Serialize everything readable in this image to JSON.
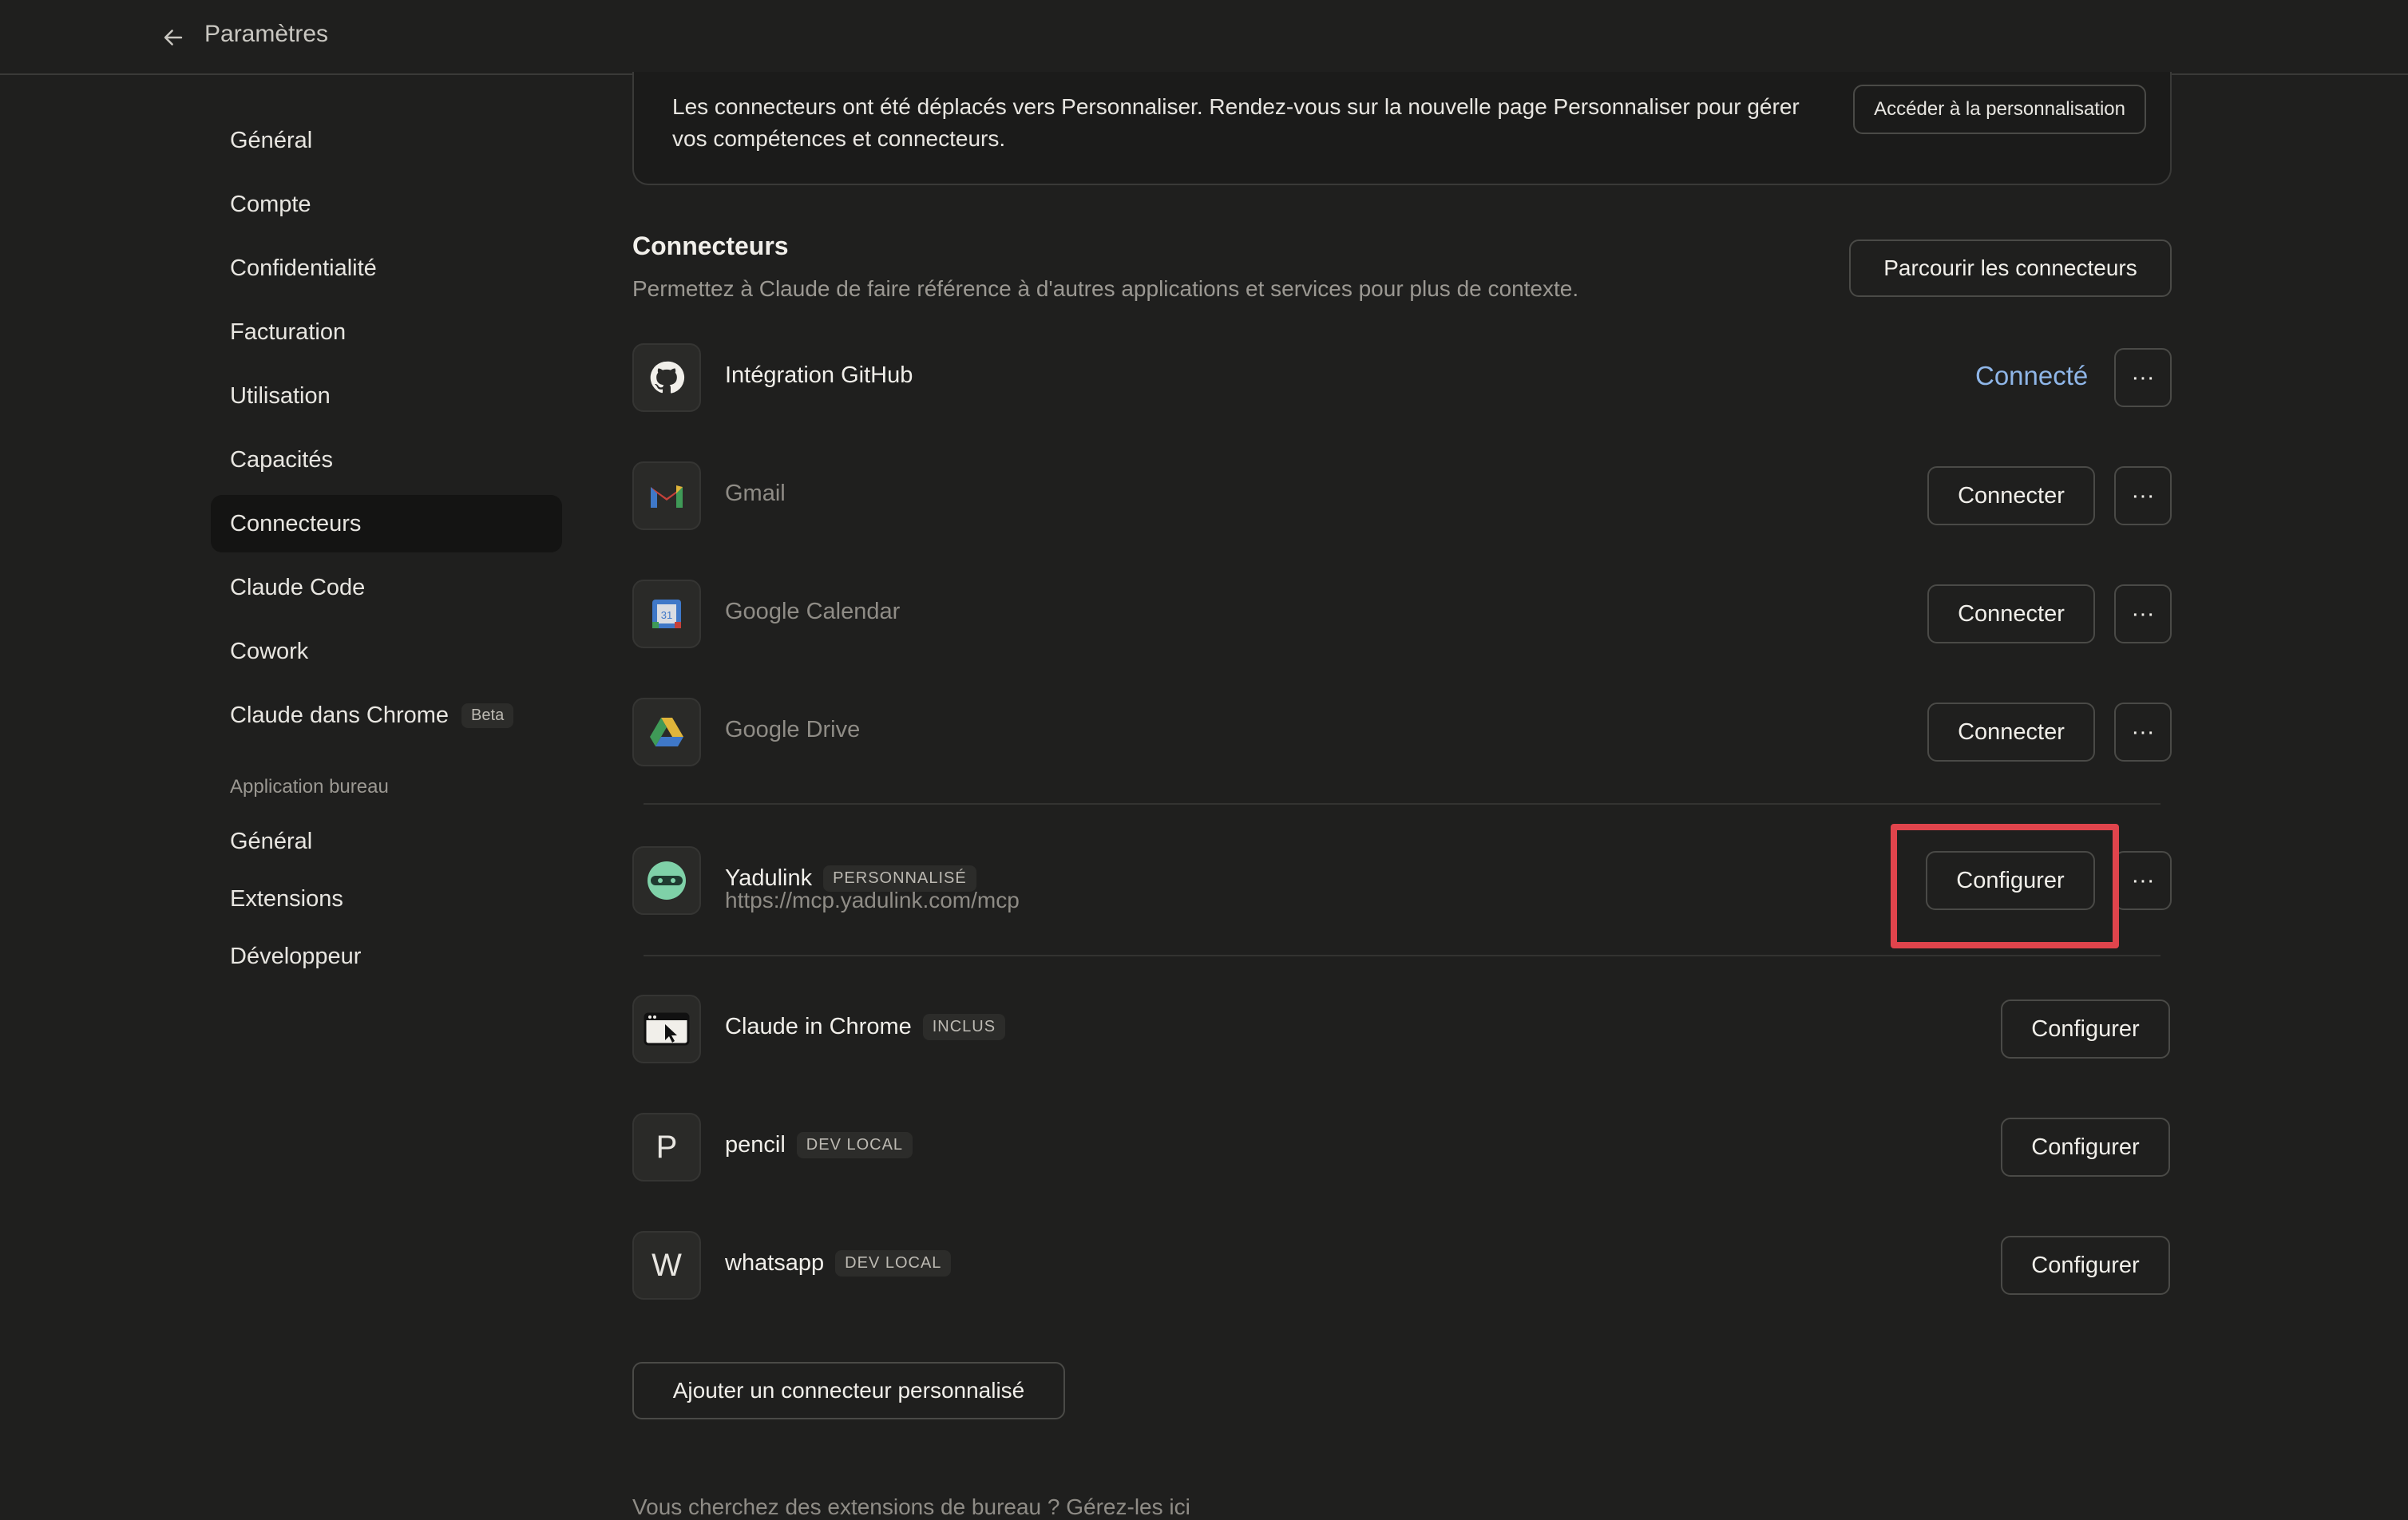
{
  "header": {
    "title": "Paramètres"
  },
  "sidebar": {
    "items": [
      {
        "label": "Général"
      },
      {
        "label": "Compte"
      },
      {
        "label": "Confidentialité"
      },
      {
        "label": "Facturation"
      },
      {
        "label": "Utilisation"
      },
      {
        "label": "Capacités"
      },
      {
        "label": "Connecteurs"
      },
      {
        "label": "Claude Code"
      },
      {
        "label": "Cowork"
      },
      {
        "label": "Claude dans Chrome",
        "badge": "Beta"
      }
    ],
    "desktop_section": "Application bureau",
    "desktop_items": [
      {
        "label": "Général"
      },
      {
        "label": "Extensions"
      },
      {
        "label": "Développeur"
      }
    ]
  },
  "banner": {
    "text": "Les connecteurs ont été déplacés vers Personnaliser. Rendez-vous sur la nouvelle page Personnaliser pour gérer vos compétences et connecteurs.",
    "button": "Accéder à la personnalisation"
  },
  "connectors": {
    "title": "Connecteurs",
    "subtitle": "Permettez à Claude de faire référence à d'autres applications et services pour plus de contexte.",
    "browse_button": "Parcourir les connecteurs",
    "items": [
      {
        "name": "Intégration GitHub",
        "status": "Connecté"
      },
      {
        "name": "Gmail",
        "action": "Connecter"
      },
      {
        "name": "Google Calendar",
        "action": "Connecter"
      },
      {
        "name": "Google Drive",
        "action": "Connecter"
      },
      {
        "name": "Yadulink",
        "tag": "PERSONNALISÉ",
        "url": "https://mcp.yadulink.com/mcp",
        "action": "Configurer"
      },
      {
        "name": "Claude in Chrome",
        "tag": "INCLUS",
        "action": "Configurer"
      },
      {
        "name": "pencil",
        "tag": "DEV LOCAL",
        "action": "Configurer",
        "letter": "P"
      },
      {
        "name": "whatsapp",
        "tag": "DEV LOCAL",
        "action": "Configurer",
        "letter": "W"
      }
    ],
    "more_label": "···",
    "add_button": "Ajouter un connecteur personnalisé",
    "footer_note": "Vous cherchez des extensions de bureau ? Gérez-les ici"
  },
  "colors": {
    "accent_link": "#8fb6e8",
    "highlight": "#e0444c",
    "background": "#1f1f1e"
  }
}
